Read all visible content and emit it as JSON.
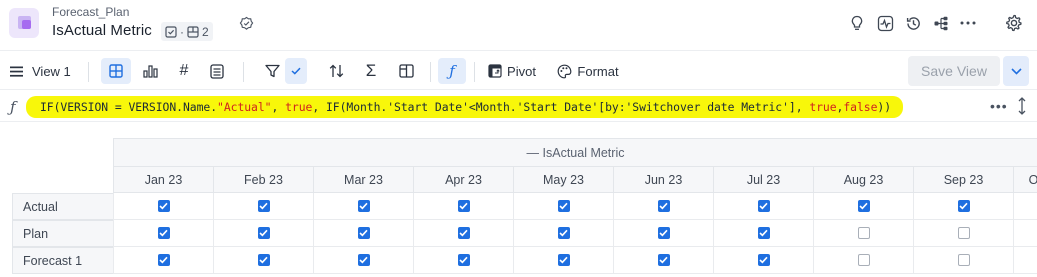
{
  "header": {
    "parent_name": "Forecast_Plan",
    "title": "IsActual Metric",
    "badge_separator": "·",
    "badge_count": "2",
    "right_icons": [
      "lightbulb-icon",
      "activity-icon",
      "history-icon",
      "hierarchy-icon",
      "more-icon",
      "settings-icon"
    ]
  },
  "toolbar": {
    "view_label": "View 1",
    "pivot_label": "Pivot",
    "format_label": "Format",
    "save_view_label": "Save View",
    "accent_color": "#1f6fe0"
  },
  "formula_bar": {
    "fx_symbol": "ƒ",
    "more_label": "•••",
    "parts": [
      {
        "t": "IF(VERSION = VERSION.Name.",
        "c": "kw"
      },
      {
        "t": "\"Actual\"",
        "c": "s"
      },
      {
        "t": ", ",
        "c": "kw"
      },
      {
        "t": "true",
        "c": "k"
      },
      {
        "t": ", IF(Month.'Start Date'<Month.'Start Date'[by:'Switchover date Metric'], ",
        "c": "kw"
      },
      {
        "t": "true",
        "c": "k"
      },
      {
        "t": ",",
        "c": "kw"
      },
      {
        "t": "false",
        "c": "k"
      },
      {
        "t": "))",
        "c": "kw"
      }
    ]
  },
  "grid": {
    "group_label": "— IsActual Metric",
    "columns": [
      "Jan 23",
      "Feb 23",
      "Mar 23",
      "Apr 23",
      "May 23",
      "Jun 23",
      "Jul 23",
      "Aug 23",
      "Sep 23",
      "O"
    ],
    "rows": [
      {
        "label": "Actual",
        "values": [
          true,
          true,
          true,
          true,
          true,
          true,
          true,
          true,
          true
        ]
      },
      {
        "label": "Plan",
        "values": [
          true,
          true,
          true,
          true,
          true,
          true,
          true,
          false,
          false
        ]
      },
      {
        "label": "Forecast 1",
        "values": [
          true,
          true,
          true,
          true,
          true,
          true,
          true,
          false,
          false
        ]
      }
    ]
  }
}
